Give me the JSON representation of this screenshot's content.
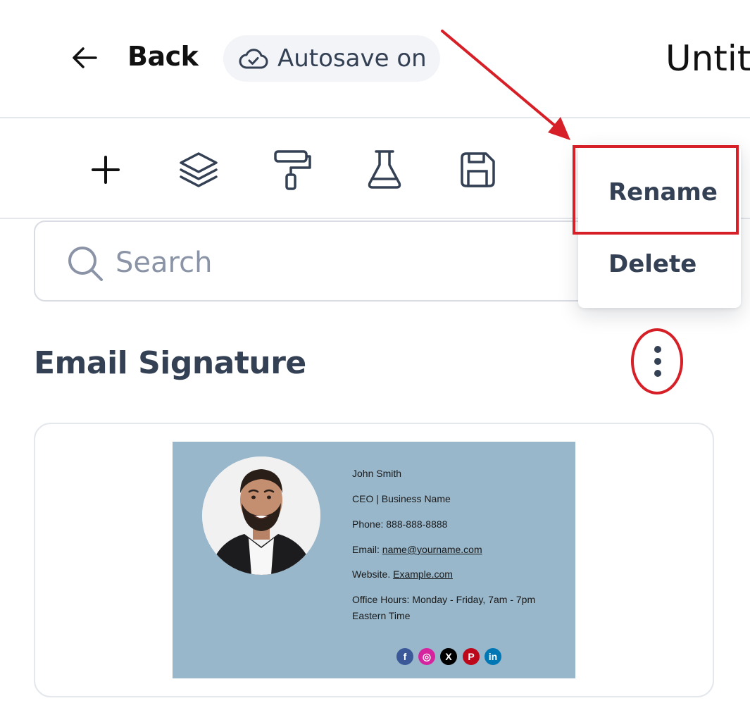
{
  "header": {
    "back_label": "Back",
    "autosave_label": "Autosave on",
    "document_title": "Untit"
  },
  "toolbar": {
    "tools": [
      {
        "icon": "plus-icon"
      },
      {
        "icon": "layers-icon"
      },
      {
        "icon": "paint-roller-icon"
      },
      {
        "icon": "flask-icon"
      },
      {
        "icon": "save-icon"
      }
    ]
  },
  "search": {
    "placeholder": "Search"
  },
  "section": {
    "title": "Email Signature"
  },
  "menu": {
    "items": [
      {
        "label": "Rename"
      },
      {
        "label": "Delete"
      }
    ]
  },
  "signature": {
    "name": "John Smith",
    "role": "CEO | Business Name",
    "phone": "Phone: 888-888-8888",
    "email_prefix": "Email: ",
    "email": "name@yourname.com",
    "website_prefix": "Website. ",
    "website": "Example.com",
    "hours_line1": "Office Hours: Monday - Friday, 7am - 7pm",
    "hours_line2": "Eastern Time",
    "socials": [
      {
        "icon": "facebook-icon",
        "glyph": "f",
        "color": "#3b5998"
      },
      {
        "icon": "instagram-icon",
        "glyph": "◎",
        "color": "#d6249f"
      },
      {
        "icon": "x-icon",
        "glyph": "X",
        "color": "#000000"
      },
      {
        "icon": "pinterest-icon",
        "glyph": "P",
        "color": "#bd081c"
      },
      {
        "icon": "linkedin-icon",
        "glyph": "in",
        "color": "#0077b5"
      }
    ],
    "background_color": "#98b7cb"
  },
  "annotation": {
    "color": "#d61f26"
  }
}
